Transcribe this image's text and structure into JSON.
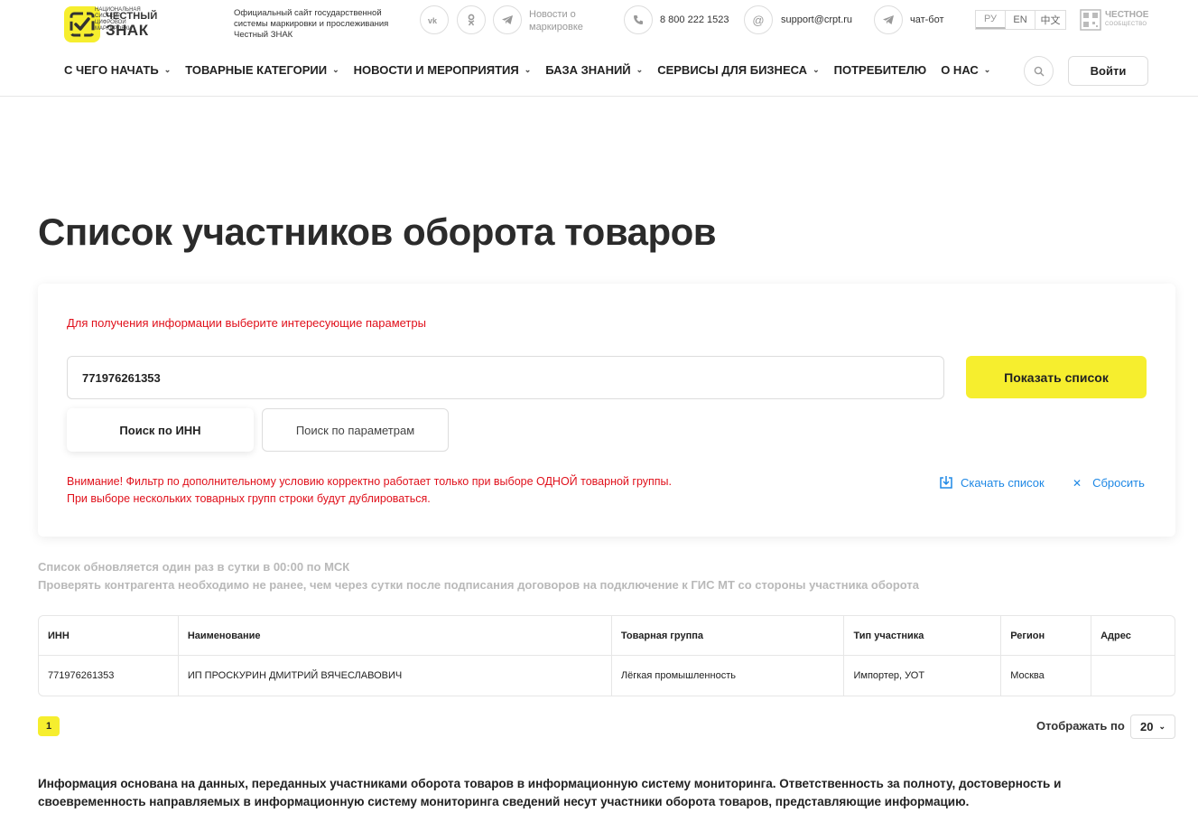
{
  "header": {
    "logo_line1": "ЧЕСТНЫЙ",
    "logo_line2": "ЗНАК",
    "logo_sub": "НАЦИОНАЛЬНАЯ СИСТЕМА ЦИФРОВОЙ МАРКИРОВКИ",
    "site_description": "Официальный сайт государственной системы маркировки и прослеживания Честный ЗНАК",
    "social": {
      "vk": "vk",
      "ok": "ok",
      "telegram": "telegram"
    },
    "news_link": "Новости о маркировке",
    "phone": "8 800 222 1523",
    "email": "support@crpt.ru",
    "chatbot": "чат-бот",
    "languages": [
      "РУ",
      "EN",
      "中文"
    ],
    "active_language": "РУ",
    "community_title": "ЧЕСТНОЕ",
    "community_sub": "СООБЩЕСТВО"
  },
  "nav": {
    "items": [
      {
        "label": "С ЧЕГО НАЧАТЬ",
        "dropdown": true
      },
      {
        "label": "ТОВАРНЫЕ КАТЕГОРИИ",
        "dropdown": true
      },
      {
        "label": "НОВОСТИ И МЕРОПРИЯТИЯ",
        "dropdown": true
      },
      {
        "label": "БАЗА ЗНАНИЙ",
        "dropdown": true
      },
      {
        "label": "СЕРВИСЫ ДЛЯ БИЗНЕСА",
        "dropdown": true
      },
      {
        "label": "ПОТРЕБИТЕЛЮ",
        "dropdown": false
      },
      {
        "label": "О НАС",
        "dropdown": true
      }
    ],
    "login_label": "Войти"
  },
  "page": {
    "title": "Список участников оборота товаров"
  },
  "filter": {
    "hint": "Для получения информации выберите интересующие параметры",
    "inn_value": "771976261353",
    "show_button": "Показать список",
    "tab_inn": "Поиск по ИНН",
    "tab_params": "Поиск по параметрам",
    "warning_line1": "Внимание! Фильтр по дополнительному условию корректно работает только при выборе ОДНОЙ товарной группы.",
    "warning_line2": "При выборе нескольких товарных групп строки будут дублироваться.",
    "download_label": "Скачать список",
    "reset_label": "Сбросить"
  },
  "notes": {
    "line1": "Список обновляется один раз в сутки в 00:00 по МСК",
    "line2": "Проверять контрагента необходимо не ранее, чем через сутки после подписания договоров на подключение к ГИС МТ со стороны участника оборота"
  },
  "table": {
    "headers": [
      "ИНН",
      "Наименование",
      "Товарная группа",
      "Тип участника",
      "Регион",
      "Адрес"
    ],
    "rows": [
      [
        "771976261353",
        "ИП ПРОСКУРИН ДМИТРИЙ ВЯЧЕСЛАВОВИЧ",
        "Лёгкая промышленность",
        "Импортер, УОТ",
        "Москва",
        ""
      ]
    ]
  },
  "pagination": {
    "current_page": "1",
    "per_page_label": "Отображать по",
    "per_page_value": "20"
  },
  "info_text": "Информация основана на данных, переданных участниками оборота товаров в информационную систему мониторинга. Ответственность за полноту, достоверность и своевременность направляемых в информационную систему мониторинга сведений несут участники оборота товаров, представляющие информацию.",
  "colors": {
    "brand_yellow": "#f6ee2e",
    "warning_red": "#e0101b",
    "link_blue": "#1e88e5"
  }
}
